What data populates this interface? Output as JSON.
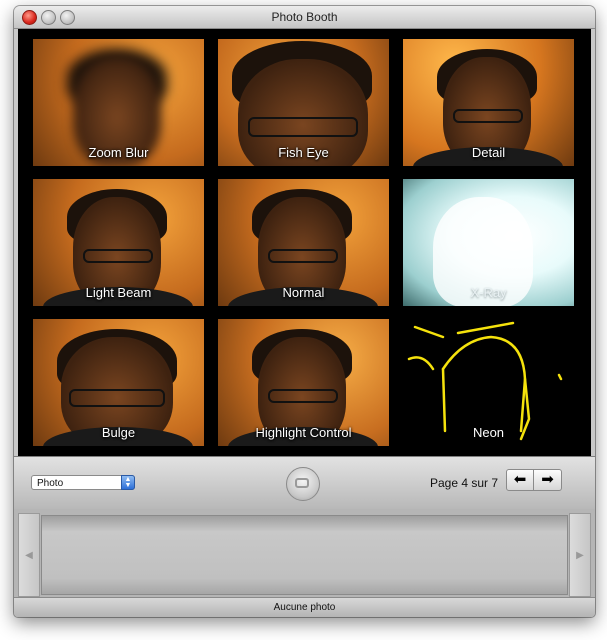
{
  "window": {
    "title": "Photo Booth"
  },
  "effects": [
    {
      "label": "Zoom Blur"
    },
    {
      "label": "Fish Eye"
    },
    {
      "label": "Detail"
    },
    {
      "label": "Light Beam"
    },
    {
      "label": "Normal"
    },
    {
      "label": "X-Ray"
    },
    {
      "label": "Bulge"
    },
    {
      "label": "Highlight Control"
    },
    {
      "label": "Neon"
    }
  ],
  "toolbar": {
    "mode_select": "Photo",
    "page_label": "Page 4 sur 7",
    "prev_icon": "arrow-left-icon",
    "next_icon": "arrow-right-icon",
    "shutter_icon": "camera-icon"
  },
  "status": {
    "text": "Aucune photo"
  },
  "colors": {
    "sepia": "#c56b1e",
    "xray": "#ddf5f5",
    "neon": "#f5e20c"
  }
}
